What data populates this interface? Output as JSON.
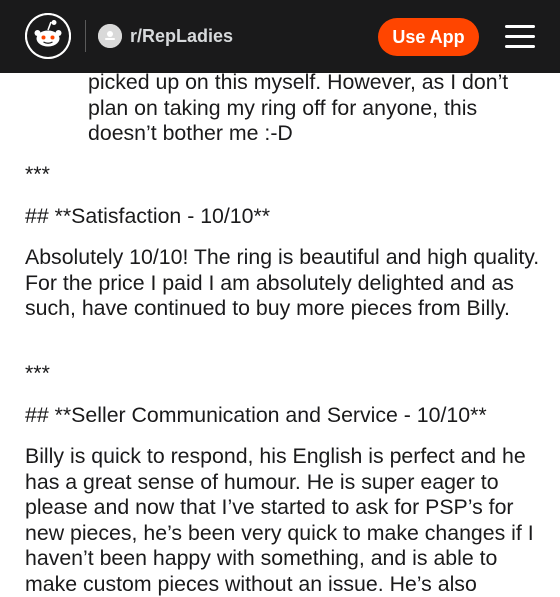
{
  "header": {
    "subreddit": "r/RepLadies",
    "use_app_label": "Use App",
    "icons": {
      "logo": "reddit-snoo-icon",
      "subreddit": "subreddit-avatar-icon",
      "menu": "hamburger-menu-icon"
    },
    "colors": {
      "bar": "#1a1a1b",
      "accent": "#ff4500"
    }
  },
  "post": {
    "quote_text": "picked up on this myself. However, as I don’t plan on taking my ring off for anyone, this doesn’t bother me :-D",
    "separator_1": "***",
    "heading_satisfaction": "## **Satisfaction - 10/10**",
    "satisfaction_text": "Absolutely 10/10! The ring is beautiful and high quality. For the price I paid I am absolutely delighted and as such, have continued to buy more pieces from Billy.",
    "separator_2": "***",
    "heading_seller": "## **Seller Communication and Service - 10/10**",
    "seller_text": "Billy is quick to respond, his English is perfect and he has a great sense of humour. He is super eager to please and now that I’ve started to ask for PSP’s for new pieces, he’s been very quick to make changes if I haven’t been happy with something, and is able to make custom pieces without an issue. He’s also"
  }
}
